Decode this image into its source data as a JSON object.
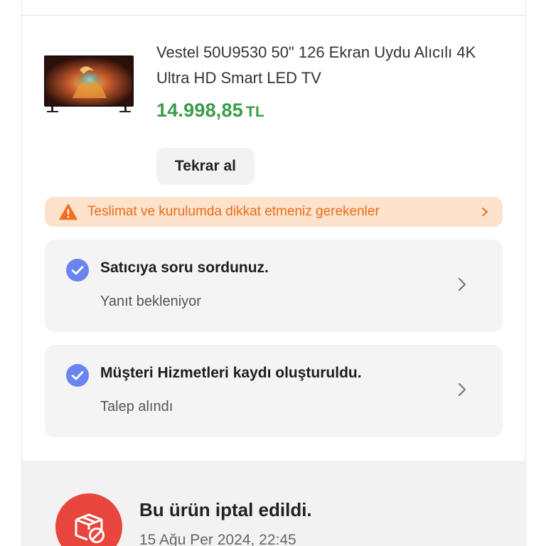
{
  "product": {
    "title": "Vestel 50U9530 50\" 126 Ekran Uydu Alıcılı 4K Ultra HD Smart LED TV",
    "price": "14.998,85",
    "currency": "TL",
    "image_icon": "tv-product-image"
  },
  "actions": {
    "rebuy_label": "Tekrar al"
  },
  "warning": {
    "text": "Teslimat ve kurulumda dikkat etmeniz gerekenler",
    "icon": "warning-triangle-icon"
  },
  "status_cards": [
    {
      "title": "Satıcıya soru sordunuz.",
      "subtitle": "Yanıt bekleniyor",
      "icon": "check-circle-icon"
    },
    {
      "title": "Müşteri Hizmetleri kaydı oluşturuldu.",
      "subtitle": "Talep alındı",
      "icon": "check-circle-icon"
    }
  ],
  "cancellation": {
    "title": "Bu ürün iptal edildi.",
    "date": "15 Ağu Per 2024, 22:45",
    "icon": "cancelled-package-icon"
  },
  "colors": {
    "price_green": "#3a9b4a",
    "warning_bg": "#fde3cd",
    "warning_orange": "#ea6b17",
    "check_blue": "#6b84f0",
    "cancel_red": "#e8453c"
  }
}
